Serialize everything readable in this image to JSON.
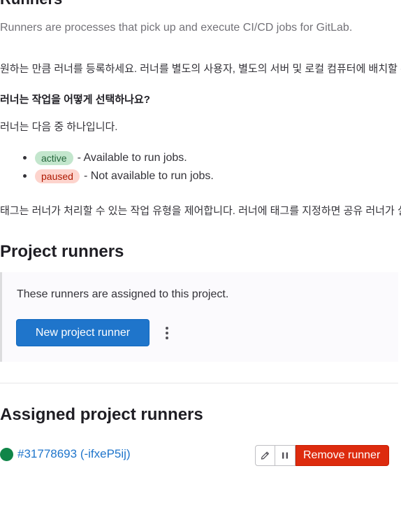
{
  "header": {
    "title": "Runners",
    "description": "Runners are processes that pick up and execute CI/CD jobs for GitLab."
  },
  "help": {
    "register_text": "원하는 만큼 러너를 등록하세요. 러너를 별도의 사용자, 별도의 서버 및 로컬 컴퓨터에 배치할 수 있습니다.",
    "question": "러너는 작업을 어떻게 선택하나요?",
    "states_intro": "러너는 다음 중 하나입니다.",
    "statuses": [
      {
        "badge": "active",
        "description": "- Available to run jobs."
      },
      {
        "badge": "paused",
        "description": "- Not available to run jobs."
      }
    ],
    "tags_text": "태그는 러너가 처리할 수 있는 작업 유형을 제어합니다. 러너에 태그를 지정하면 공유 러너가 실행할 수 있는 작업만 처리하도록 할 수 있습니다."
  },
  "project_runners": {
    "title": "Project runners",
    "assigned_text": "These runners are assigned to this project.",
    "new_button_label": "New project runner",
    "more_actions_icon": "ellipsis-v-icon"
  },
  "assigned_runners": {
    "title": "Assigned project runners",
    "runners": [
      {
        "link_text": "#31778693 (-ifxeP5ij)",
        "status": "online",
        "status_color": "#108548",
        "edit_icon": "pencil-icon",
        "pause_icon": "pause-icon",
        "remove_label": "Remove runner"
      }
    ]
  },
  "colors": {
    "primary": "#1f75cb",
    "danger": "#dd2b0e",
    "online": "#108548",
    "active_badge_bg": "#c3e6cd",
    "paused_badge_bg": "#fdd4cd"
  }
}
